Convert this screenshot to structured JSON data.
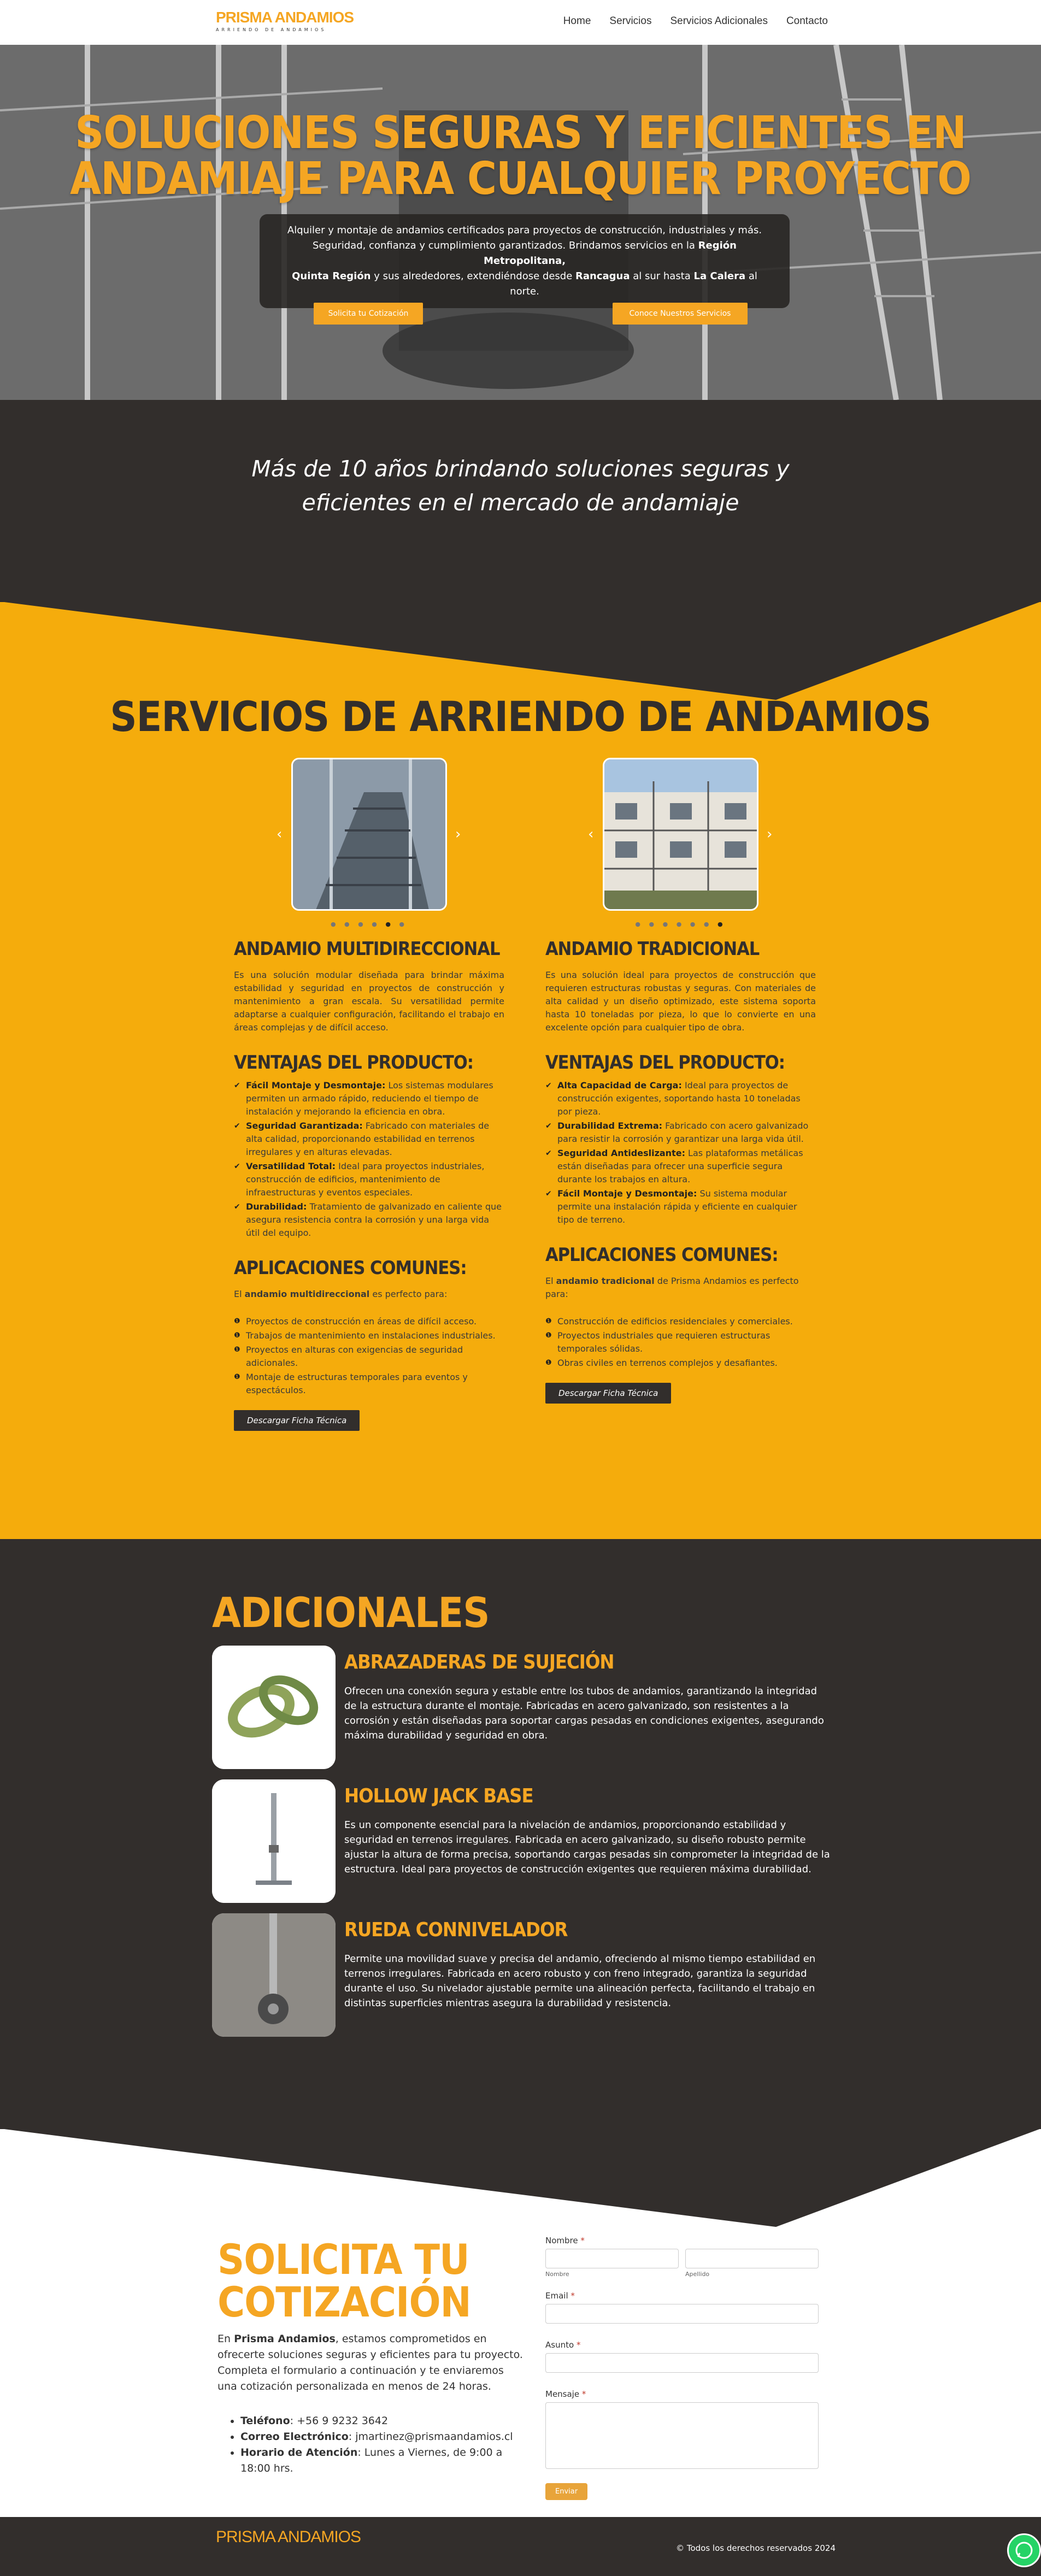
{
  "header": {
    "logo": "PRISMA ANDAMIOS",
    "logo_sub": "ARRIENDO DE ANDAMIOS",
    "nav": [
      "Home",
      "Servicios",
      "Servicios Adicionales",
      "Contacto"
    ]
  },
  "hero": {
    "title_l1": "SOLUCIONES SEGURAS Y EFICIENTES EN",
    "title_l2": "ANDAMIAJE PARA CUALQUIER PROYECTO",
    "p1": "Alquiler y montaje de andamios certificados para proyectos de construcción, industriales y más.",
    "p2": "Seguridad, confianza y cumplimiento garantizados. Brindamos servicios en la ",
    "p2b": "Región Metropolitana,",
    "p3b": "Quinta Región",
    "p3": " y sus alrededores, extendiéndose desde ",
    "p3c": "Rancagua",
    "p3d": " al sur hasta ",
    "p3e": "La Calera",
    "p3f": " al norte.",
    "btn1": "Solicita tu Cotización",
    "btn2": "Conoce Nuestros Servicios"
  },
  "band": {
    "l1": "Más de 10 años brindando soluciones seguras y",
    "l2": "eficientes en el mercado de andamiaje"
  },
  "services": {
    "title": "SERVICIOS DE ARRIENDO DE ANDAMIOS",
    "left": {
      "title": "ANDAMIO MULTIDIRECCIONAL",
      "desc": "Es una solución modular diseñada para brindar máxima estabilidad y seguridad en proyectos de construcción y mantenimiento a gran escala. Su versatilidad permite adaptarse a cualquier configuración, facilitando el trabajo en áreas complejas y de difícil acceso.",
      "adv_title": "VENTAJAS DEL PRODUCTO:",
      "adv": [
        {
          "b": "Fácil Montaje y Desmontaje:",
          "t": " Los sistemas modulares permiten un armado rápido, reduciendo el tiempo de instalación y mejorando la eficiencia en obra."
        },
        {
          "b": "Seguridad Garantizada:",
          "t": " Fabricado con materiales de alta calidad, proporcionando estabilidad en terrenos irregulares y en alturas elevadas."
        },
        {
          "b": "Versatilidad Total:",
          "t": " Ideal para proyectos industriales, construcción de edificios, mantenimiento de infraestructuras y eventos especiales."
        },
        {
          "b": "Durabilidad:",
          "t": " Tratamiento de galvanizado en caliente que asegura resistencia contra la corrosión y una larga vida útil del equipo."
        }
      ],
      "app_title": "APLICACIONES COMUNES:",
      "app_intro_a": "El ",
      "app_intro_b": "andamio multidireccional",
      "app_intro_c": " es perfecto para:",
      "apps": [
        "Proyectos de construcción en áreas de difícil acceso.",
        "Trabajos de mantenimiento en instalaciones industriales.",
        "Proyectos en alturas con exigencias de seguridad adicionales.",
        "Montaje de estructuras temporales para eventos y espectáculos."
      ],
      "btn": "Descargar Ficha Técnica"
    },
    "right": {
      "title": "ANDAMIO TRADICIONAL",
      "desc": "Es una solución ideal para proyectos de construcción que requieren estructuras robustas y seguras. Con materiales de alta calidad y un diseño optimizado, este sistema soporta hasta 10 toneladas por pieza, lo que lo convierte en una excelente opción para cualquier tipo de obra.",
      "adv_title": "VENTAJAS DEL PRODUCTO:",
      "adv": [
        {
          "b": "Alta Capacidad de Carga:",
          "t": " Ideal para proyectos de construcción exigentes, soportando hasta 10 toneladas por pieza."
        },
        {
          "b": "Durabilidad Extrema:",
          "t": " Fabricado con acero galvanizado para resistir la corrosión y garantizar una larga vida útil."
        },
        {
          "b": "Seguridad Antideslizante:",
          "t": " Las plataformas metálicas están diseñadas para ofrecer una superficie segura durante los trabajos en altura."
        },
        {
          "b": "Fácil Montaje y Desmontaje:",
          "t": " Su sistema modular permite una instalación rápida y eficiente en cualquier tipo de terreno."
        }
      ],
      "app_title": "APLICACIONES COMUNES:",
      "app_intro_a": "El ",
      "app_intro_b": "andamio tradicional",
      "app_intro_c": " de Prisma Andamios es perfecto para:",
      "apps": [
        "Construcción de edificios residenciales y comerciales.",
        "Proyectos industriales que requieren estructuras temporales sólidas.",
        "Obras civiles en terrenos complejos y desafiantes."
      ],
      "btn": "Descargar Ficha Técnica"
    }
  },
  "adicionales": {
    "title": "ADICIONALES",
    "items": [
      {
        "title": "ABRAZADERAS DE SUJECIÓN",
        "desc": "Ofrecen una conexión segura y estable entre los tubos de andamios, garantizando la integridad de la estructura durante el montaje. Fabricadas en acero galvanizado, son resistentes a la corrosión y están diseñadas para soportar cargas pesadas en condiciones exigentes, asegurando máxima durabilidad y seguridad en obra."
      },
      {
        "title": "HOLLOW JACK BASE",
        "desc": "Es un componente esencial para la nivelación de andamios, proporcionando estabilidad y seguridad en terrenos irregulares. Fabricada en acero galvanizado, su diseño robusto permite ajustar la altura de forma precisa, soportando cargas pesadas sin comprometer la integridad de la estructura. Ideal para proyectos de construcción exigentes que requieren máxima durabilidad."
      },
      {
        "title": "RUEDA CONNIVELADOR",
        "desc": "Permite una movilidad suave y precisa del andamio, ofreciendo al mismo tiempo estabilidad en terrenos irregulares. Fabricada en acero robusto y con freno integrado, garantiza la seguridad durante el uso. Su nivelador ajustable permite una alineación perfecta, facilitando el trabajo en distintas superficies mientras asegura la durabilidad y resistencia."
      }
    ]
  },
  "cotizacion": {
    "title_l1": "SOLICITA TU",
    "title_l2": "COTIZACIÓN",
    "p_a": "En ",
    "p_b": "Prisma Andamios",
    "p_c": ", estamos comprometidos en ofrecerte soluciones seguras y eficientes para tu proyecto. Completa el formulario a continuación y te enviaremos una cotización personalizada en menos de 24 horas.",
    "contact": [
      {
        "b": "Teléfono",
        "t": ": +56 9 9232 3642"
      },
      {
        "b": "Correo Electrónico",
        "t": ": jmartinez@prismaandamios.cl"
      },
      {
        "b": "Horario de Atención",
        "t": ": Lunes a Viernes, de 9:00 a 18:00 hrs."
      }
    ],
    "form": {
      "nombre": "Nombre",
      "nombre_sub": "Nombre",
      "apellido_sub": "Apellido",
      "email": "Email",
      "asunto": "Asunto",
      "mensaje": "Mensaje",
      "req": "*",
      "submit": "Enviar"
    }
  },
  "footer": {
    "logo": "PRISMA ANDAMIOS",
    "copy": "© Todos los derechos reservados 2024"
  }
}
